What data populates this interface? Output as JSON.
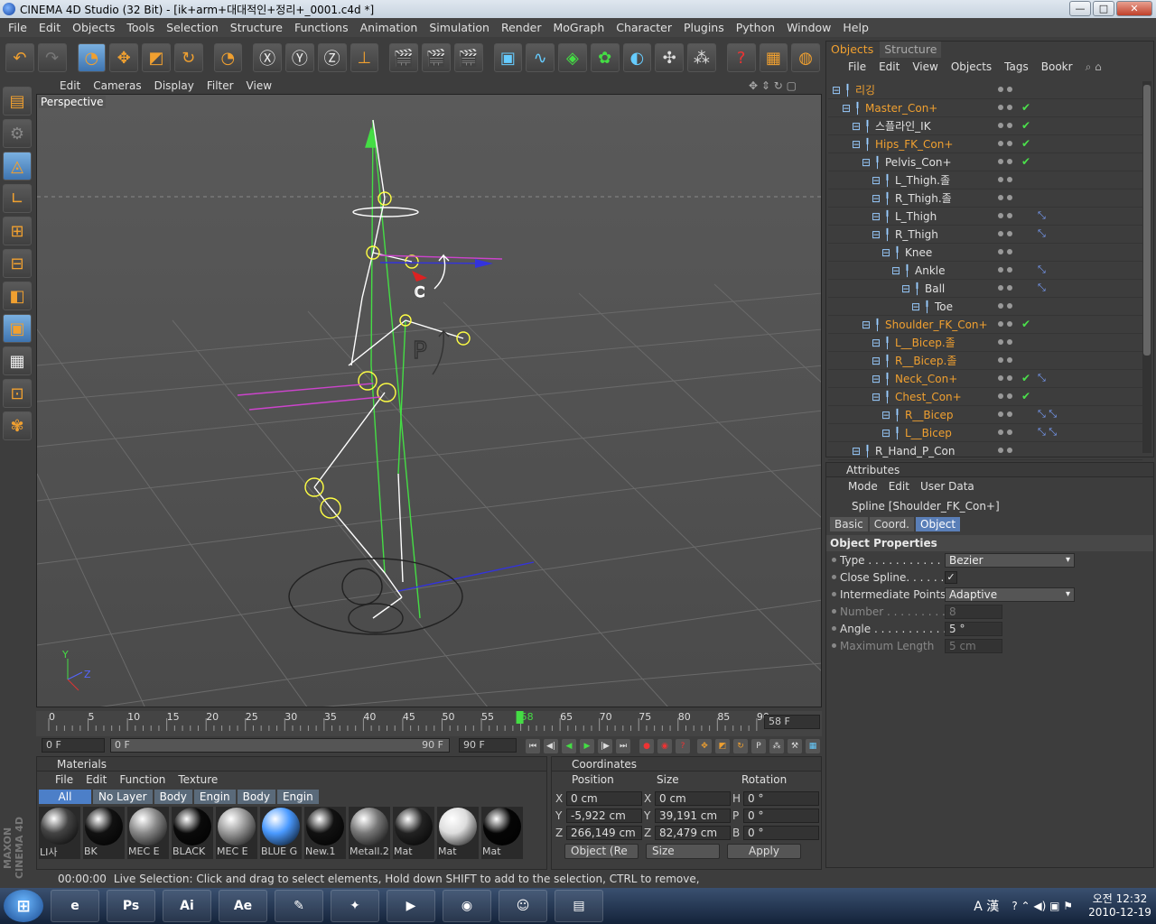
{
  "window": {
    "title": "CINEMA 4D Studio (32 Bit) - [ik+arm+대대적인+정리+_0001.c4d *]",
    "min": "—",
    "max": "□",
    "close": "✕"
  },
  "menu": [
    "File",
    "Edit",
    "Objects",
    "Tools",
    "Selection",
    "Structure",
    "Functions",
    "Animation",
    "Simulation",
    "Render",
    "MoGraph",
    "Character",
    "Plugins",
    "Python",
    "Window",
    "Help"
  ],
  "viewport": {
    "menu": [
      "Edit",
      "Cameras",
      "Display",
      "Filter",
      "View"
    ],
    "label": "Perspective"
  },
  "timeline": {
    "ticks": [
      "0",
      "5",
      "10",
      "15",
      "20",
      "25",
      "30",
      "35",
      "40",
      "45",
      "50",
      "55",
      "58",
      "65",
      "70",
      "75",
      "80",
      "85",
      "90"
    ],
    "current": "58 F"
  },
  "transport": {
    "start": "0 F",
    "range_start": "0 F",
    "range_end": "90 F",
    "end": "90 F"
  },
  "materials": {
    "title": "Materials",
    "menu": [
      "File",
      "Edit",
      "Function",
      "Texture"
    ],
    "tabs": [
      "All",
      "No Layer",
      "Body",
      "Engin",
      "Body",
      "Engin"
    ],
    "items": [
      {
        "name": "LI사",
        "color": "#444"
      },
      {
        "name": "BK",
        "color": "#111"
      },
      {
        "name": "MEC E",
        "color": "#888"
      },
      {
        "name": "BLACK",
        "color": "#0a0a0a"
      },
      {
        "name": "MEC E",
        "color": "#999"
      },
      {
        "name": "BLUE G",
        "color": "#4a9aff"
      },
      {
        "name": "New.1",
        "color": "#111"
      },
      {
        "name": "Metall.2",
        "color": "#777"
      },
      {
        "name": "Mat",
        "color": "#222"
      },
      {
        "name": "Mat",
        "color": "#ddd"
      },
      {
        "name": "Mat",
        "color": "#050505"
      }
    ]
  },
  "coordinates": {
    "title": "Coordinates",
    "headers": [
      "Position",
      "Size",
      "Rotation"
    ],
    "rows": [
      {
        "a": "X",
        "pos": "0 cm",
        "b": "X",
        "size": "0 cm",
        "c": "H",
        "rot": "0 °"
      },
      {
        "a": "Y",
        "pos": "-5,922 cm",
        "b": "Y",
        "size": "39,191 cm",
        "c": "P",
        "rot": "0 °"
      },
      {
        "a": "Z",
        "pos": "266,149 cm",
        "b": "Z",
        "size": "82,479 cm",
        "c": "B",
        "rot": "0 °"
      }
    ],
    "mode": "Object (Re",
    "size_mode": "Size",
    "apply": "Apply"
  },
  "status": {
    "time": "00:00:00",
    "text": "Live Selection: Click and drag to select elements, Hold down SHIFT to add to the selection, CTRL to remove,"
  },
  "objects": {
    "tabs": [
      "Objects",
      "Structure"
    ],
    "menu": [
      "File",
      "Edit",
      "View",
      "Objects",
      "Tags",
      "Bookr"
    ],
    "tree": [
      {
        "name": "리깅",
        "indent": 0,
        "color": "#f0a030",
        "check": false,
        "tag": ""
      },
      {
        "name": "Master_Con+",
        "indent": 1,
        "color": "#f0a030",
        "check": true,
        "tag": ""
      },
      {
        "name": "스플라인_IK",
        "indent": 2,
        "color": "#e0e0e0",
        "check": true,
        "tag": ""
      },
      {
        "name": "Hips_FK_Con+",
        "indent": 2,
        "color": "#f0a030",
        "check": true,
        "tag": ""
      },
      {
        "name": "Pelvis_Con+",
        "indent": 3,
        "color": "#e0e0e0",
        "check": true,
        "tag": ""
      },
      {
        "name": "L_Thigh.졸",
        "indent": 4,
        "color": "#e0e0e0",
        "check": false,
        "tag": ""
      },
      {
        "name": "R_Thigh.졸",
        "indent": 4,
        "color": "#e0e0e0",
        "check": false,
        "tag": ""
      },
      {
        "name": "L_Thigh",
        "indent": 4,
        "color": "#e0e0e0",
        "check": false,
        "tag": "⤡"
      },
      {
        "name": "R_Thigh",
        "indent": 4,
        "color": "#e0e0e0",
        "check": false,
        "tag": "⤡"
      },
      {
        "name": "Knee",
        "indent": 5,
        "color": "#e0e0e0",
        "check": false,
        "tag": ""
      },
      {
        "name": "Ankle",
        "indent": 6,
        "color": "#e0e0e0",
        "check": false,
        "tag": "⤡"
      },
      {
        "name": "Ball",
        "indent": 7,
        "color": "#e0e0e0",
        "check": false,
        "tag": "⤡"
      },
      {
        "name": "Toe",
        "indent": 8,
        "color": "#e0e0e0",
        "check": false,
        "tag": ""
      },
      {
        "name": "Shoulder_FK_Con+",
        "indent": 3,
        "color": "#f0a030",
        "check": true,
        "tag": ""
      },
      {
        "name": "L__Bicep.졸",
        "indent": 4,
        "color": "#f0a030",
        "check": false,
        "tag": ""
      },
      {
        "name": "R__Bicep.졸",
        "indent": 4,
        "color": "#f0a030",
        "check": false,
        "tag": ""
      },
      {
        "name": "Neck_Con+",
        "indent": 4,
        "color": "#f0a030",
        "check": true,
        "tag": "⤡"
      },
      {
        "name": "Chest_Con+",
        "indent": 4,
        "color": "#f0a030",
        "check": true,
        "tag": ""
      },
      {
        "name": "R__Bicep",
        "indent": 5,
        "color": "#f0a030",
        "check": false,
        "tag": "⤡ ⤡"
      },
      {
        "name": "L__Bicep",
        "indent": 5,
        "color": "#f0a030",
        "check": false,
        "tag": "⤡ ⤡"
      },
      {
        "name": "R_Hand_P_Con",
        "indent": 2,
        "color": "#e0e0e0",
        "check": false,
        "tag": ""
      }
    ]
  },
  "attributes": {
    "title": "Attributes",
    "menu": [
      "Mode",
      "Edit",
      "User Data"
    ],
    "object": "Spline [Shoulder_FK_Con+]",
    "tabs": [
      "Basic",
      "Coord.",
      "Object"
    ],
    "section": "Object Properties",
    "type_label": "Type . . . . . . . . . . . . . .",
    "type_value": "Bezier",
    "close_label": "Close Spline. . . . . . . .",
    "close_value": "✓",
    "ip_label": "Intermediate Points",
    "ip_value": "Adaptive",
    "num_label": "Number . . . . . . . . . . .",
    "num_value": "8",
    "angle_label": "Angle . . . . . . . . . . . . .",
    "angle_value": "5 °",
    "max_label": "Maximum Length",
    "max_value": "5 cm"
  },
  "taskbar": {
    "apps": [
      "e",
      "Ps",
      "Ai",
      "Ae",
      "✎",
      "✦",
      "▶",
      "◉",
      "☺",
      "▤"
    ],
    "ime": "A 漢",
    "time": "오전 12:32",
    "date": "2010-12-19"
  },
  "maxon": "MAXON CINEMA 4D"
}
